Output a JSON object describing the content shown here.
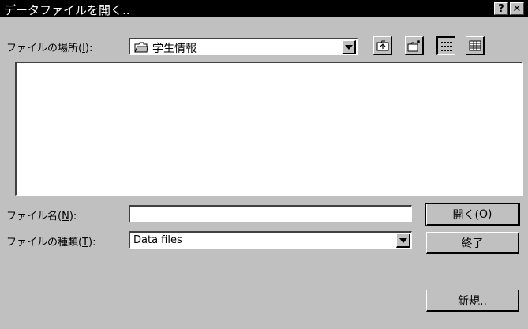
{
  "window": {
    "title": "データファイルを開く..",
    "help_button": "?",
    "close_button": "✕"
  },
  "location": {
    "label_prefix": "ファイルの場所(",
    "label_key": "I",
    "label_suffix": "):",
    "value": "学生情報",
    "icon": "folder-icon"
  },
  "toolbar": {
    "up_folder_icon": "up-folder-icon",
    "new_folder_icon": "new-folder-icon",
    "list_view_icon": "list-view-icon",
    "details_view_icon": "details-view-icon"
  },
  "file_name": {
    "label_prefix": "ファイル名(",
    "label_key": "N",
    "label_suffix": "):",
    "value": ""
  },
  "file_type": {
    "label_prefix": "ファイルの種類(",
    "label_key": "T",
    "label_suffix": "):",
    "value": "Data files"
  },
  "buttons": {
    "open_prefix": "開く(",
    "open_key": "O",
    "open_suffix": ")",
    "exit": "終了",
    "new": "新規.."
  }
}
